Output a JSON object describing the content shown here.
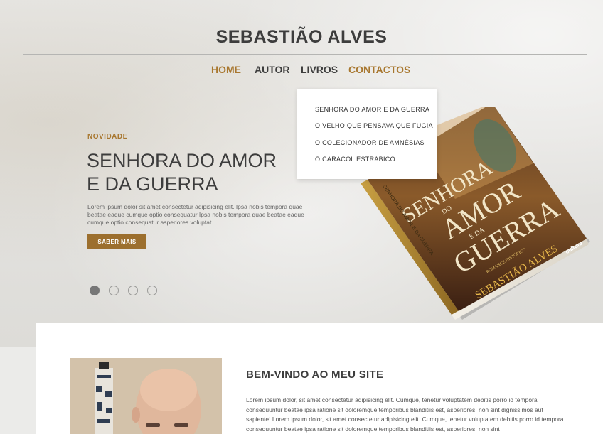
{
  "header": {
    "site_title": "SEBASTIÃO ALVES"
  },
  "nav": {
    "items": [
      {
        "label": "HOME",
        "active": true
      },
      {
        "label": "AUTOR",
        "active": false
      },
      {
        "label": "LIVROS",
        "active": false
      },
      {
        "label": "CONTACTOS",
        "active": false
      }
    ],
    "dropdown": [
      "SENHORA DO AMOR E DA GUERRA",
      "O VELHO QUE PENSAVA QUE FUGIA",
      "O COLECIONADOR DE AMNÉSIAS",
      "O CARACOL ESTRÁBICO"
    ]
  },
  "hero": {
    "badge": "NOVIDADE",
    "title_line1": "SENHORA DO AMOR",
    "title_line2": "E DA GUERRA",
    "text": "Lorem ipsum dolor sit amet consectetur adipisicing elit. Ipsa nobis tempora quae beatae eaque cumque optio consequatur Ipsa nobis tempora quae beatae eaque cumque optio consequatur asperiores voluptat. ...",
    "button_label": "SABER MAIS",
    "slides_total": 4,
    "slide_active": 1,
    "book": {
      "title_top": "SENHORA",
      "title_do": "DO",
      "title_amor": "AMOR",
      "title_eda": "E DA",
      "title_guerra": "GUERRA",
      "subtitle": "ROMANCE HISTÓRICO",
      "author": "SEBASTIÃO ALVES",
      "publisher": "cultura",
      "spine_text": "SENHORA DO AMOR E DA GUERRA"
    }
  },
  "welcome": {
    "title": "BEM-VINDO AO MEU SITE",
    "text": "Lorem ipsum dolor, sit amet consectetur adipisicing elit. Cumque, tenetur voluptatem debitis porro id tempora consequuntur beatae ipsa ratione sit doloremque temporibus blanditiis est, asperiores, non sint dignissimos aut sapiente! Lorem ipsum dolor, sit amet consectetur adipisicing elit. Cumque, tenetur voluptatem debitis porro id tempora consequuntur beatae ipsa ratione sit doloremque temporibus blanditiis est, asperiores, non sint"
  },
  "colors": {
    "accent": "#a8772f",
    "button": "#9c6f2e",
    "text_dark": "#3d3d3d"
  }
}
